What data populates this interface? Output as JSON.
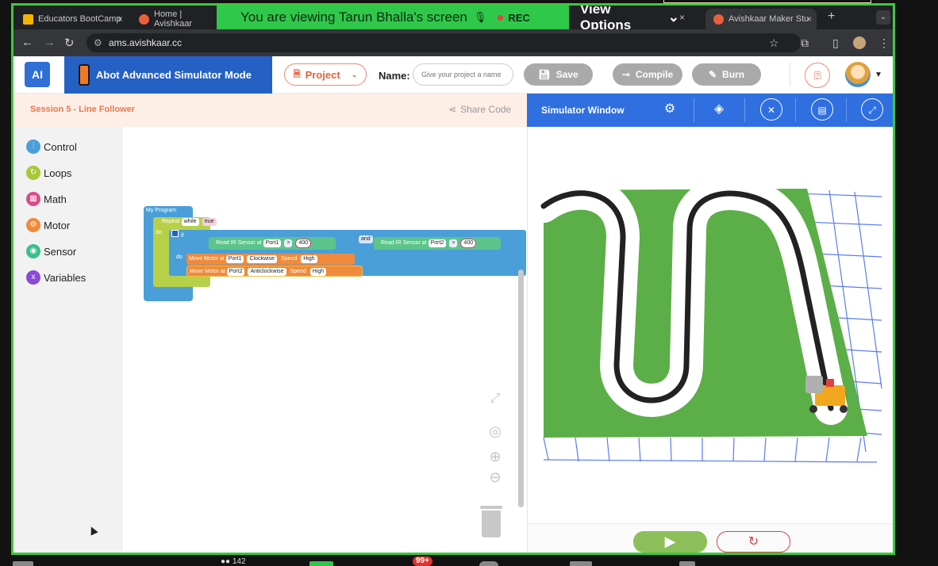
{
  "zoom": {
    "banner_text": "You are viewing  Tarun Bhalla's screen",
    "rec_label": "REC",
    "view_options": "View Options",
    "participants_count": "142",
    "chat_badge": "99+"
  },
  "browser": {
    "tabs": [
      {
        "title": "Educators BootCamp",
        "favicon_color": "#f4b400"
      },
      {
        "title": "Home | Avishkaar",
        "favicon_color": "#e8603c"
      },
      {
        "title": "Avishkaar Maker Stu",
        "favicon_color": "#e8603c"
      }
    ],
    "close_glyph": "×",
    "new_tab": "+",
    "tab_menu": "⌄",
    "url": "ams.avishkaar.cc",
    "back": "←",
    "forward": "→",
    "reload": "↻",
    "star": "☆",
    "extensions": "⧉",
    "split": "▯",
    "menu": "⋮"
  },
  "app": {
    "logo_text": "AI",
    "mode_title": "Abot Advanced Simulator Mode",
    "project_label": "Project",
    "name_label": "Name:",
    "name_placeholder": "Give your project a name",
    "save_label": "Save",
    "compile_label": "Compile",
    "burn_label": "Burn",
    "session_title": "Session 5 - Line Follower",
    "share_code": "Share Code",
    "simulator_title": "Simulator Window"
  },
  "palette": {
    "categories": [
      {
        "label": "Control",
        "color": "#4a9fd8",
        "glyph": "⫶"
      },
      {
        "label": "Loops",
        "color": "#a8c83a",
        "glyph": "↻"
      },
      {
        "label": "Math",
        "color": "#d94c8a",
        "glyph": "▦"
      },
      {
        "label": "Motor",
        "color": "#f08a3c",
        "glyph": "⚙"
      },
      {
        "label": "Sensor",
        "color": "#3cbf8a",
        "glyph": "◉"
      },
      {
        "label": "Variables",
        "color": "#8a4ad8",
        "glyph": "x"
      }
    ]
  },
  "blocks": {
    "program": "My Program",
    "repeat": "Repeat",
    "while": "while",
    "true_val": "true",
    "do": "do",
    "if": "if",
    "read_ir_1": "Read IR Sensor at",
    "port1": "Port1",
    "gt": ">",
    "val1": "400",
    "and": "and",
    "read_ir_2": "Read IR Sensor at",
    "port2": "Port2",
    "val2": "400",
    "do2": "do",
    "move1": "Move Motor at",
    "move1_port": "Port1",
    "move1_dir": "Clockwise",
    "speed": "Speed",
    "move1_speed": "High",
    "move2": "Move Motor at",
    "move2_port": "Port2",
    "move2_dir": "Anticlockwise",
    "move2_speed": "High"
  },
  "colors": {
    "zoom_green": "#2fc84a",
    "app_blue": "#2561c4",
    "accent_orange": "#e8603c",
    "field_green": "#5cae48",
    "track_black": "#222222"
  }
}
